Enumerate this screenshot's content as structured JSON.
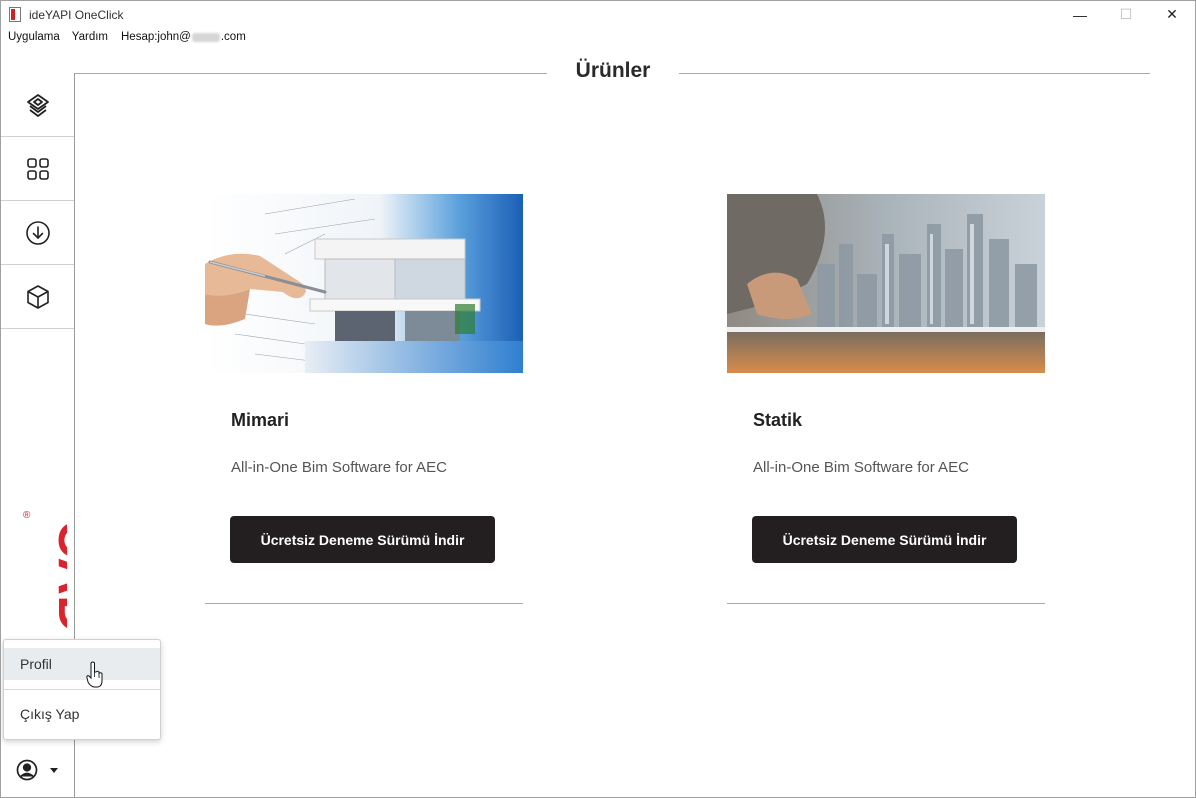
{
  "window": {
    "title": "ideYAPI OneClick",
    "controls": {
      "minimize": "—",
      "maximize": "☐",
      "close": "✕"
    }
  },
  "menu": {
    "items": [
      "Uygulama",
      "Yardım"
    ],
    "account_prefix": "Hesap:john@",
    "account_suffix": ".com"
  },
  "sidebar": {
    "items": [
      {
        "icon": "layers-icon"
      },
      {
        "icon": "grid-icon"
      },
      {
        "icon": "download-icon"
      },
      {
        "icon": "cube-icon"
      }
    ],
    "brand_color": "#d9232d",
    "brand_text": "CAD",
    "brand_mark": "®"
  },
  "page": {
    "title": "Ürünler"
  },
  "products": [
    {
      "title": "Mimari",
      "description": "All-in-One Bim Software for AEC",
      "button": "Ücretsiz Deneme Sürümü İndir"
    },
    {
      "title": "Statik",
      "description": "All-in-One Bim Software for AEC",
      "button": "Ücretsiz Deneme Sürümü İndir"
    }
  ],
  "dropdown": {
    "items": [
      "Profil",
      "Çıkış Yap"
    ]
  },
  "colors": {
    "button_bg": "#231f20",
    "accent": "#d9232d"
  }
}
